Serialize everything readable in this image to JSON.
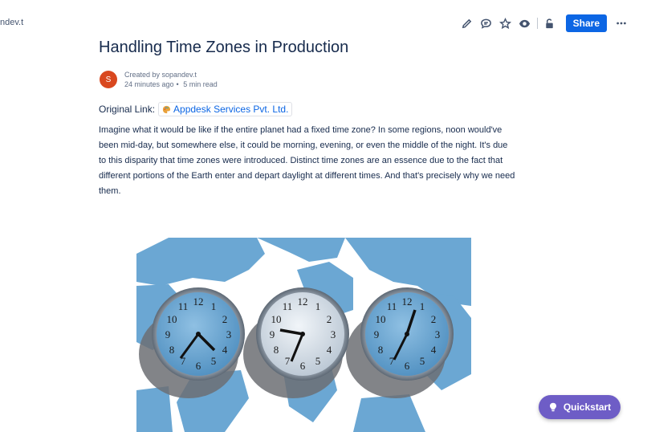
{
  "breadcrumb": {
    "text": "ndev.t"
  },
  "toolbar": {
    "icons": [
      "edit-icon",
      "comment-icon",
      "star-icon",
      "watch-icon",
      "restrictions-icon"
    ],
    "share_label": "Share",
    "more_icon": "more-icon"
  },
  "page": {
    "title": "Handling Time Zones in Production",
    "author_initial": "S",
    "created_by": "Created by sopandev.t",
    "time_ago": "24 minutes ago",
    "separator": "•",
    "read_time": "5 min read",
    "original_link_label": "Original Link:",
    "link_text": "Appdesk Services Pvt. Ltd.",
    "body": "Imagine what it would be like if the entire planet had a fixed time zone? In some regions, noon would've been mid-day, but somewhere else, it could be morning, evening, or even the middle of the night. It's due to this disparity that time zones were introduced. Distinct time zones are an essence due to the fact that different portions of the Earth enter and depart daylight at different times. And that's precisely why we need them."
  },
  "image": {
    "clock_numbers": [
      "12",
      "1",
      "2",
      "3",
      "4",
      "5",
      "6",
      "7",
      "8",
      "9",
      "10",
      "11"
    ]
  },
  "quickstart": {
    "label": "Quickstart"
  },
  "colors": {
    "primary": "#0c66e4",
    "avatar": "#d9481f",
    "quickstart": "#6e5dc6",
    "map_blue": "#6ba7d3"
  }
}
